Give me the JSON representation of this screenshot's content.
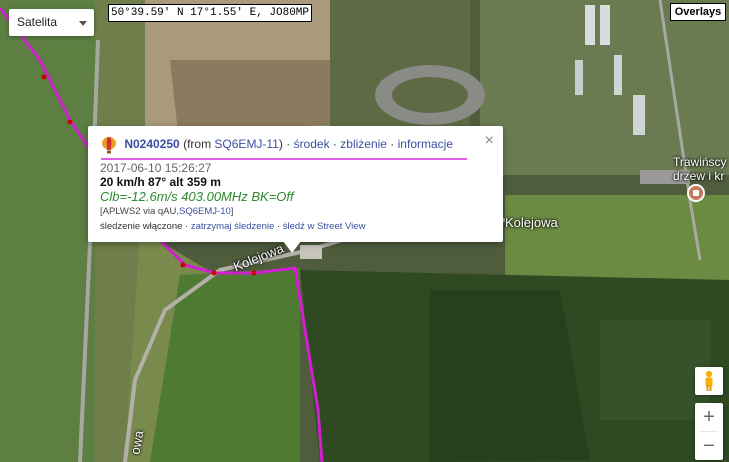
{
  "map": {
    "map_type": "Satelita",
    "coordinates": "50°39.59' N 17°1.55' E, JO80MP",
    "overlays_label": "Overlays",
    "zoom_in": "+",
    "zoom_out": "−",
    "road_label_1": "Kolejowa",
    "road_label_2": "Kolejowa",
    "road_label_3": "owa",
    "poi_label": "Trawińscy\ndrzew i kr",
    "track_color": "#d020d0",
    "marker_color": "#cc0000"
  },
  "popup": {
    "callsign": "N0240250",
    "from_prefix": "(from",
    "from_call": "SQ6EMJ-11",
    "from_suffix": ")",
    "sep": " · ",
    "link_center": "środek",
    "link_zoom": "zbliżenie",
    "link_info": "informacje",
    "timestamp": "2017-06-10 15:26:27",
    "speed_line": "20 km/h 87° alt 359 m",
    "comment": "Clb=-12.6m/s 403.00MHz BK=Off",
    "path_prefix": "[APLWS2 via qAU,",
    "path_call": "SQ6EMJ-10",
    "path_suffix": "]",
    "tracking_text": "śledzenie włączone",
    "link_stop": "zatrzymaj śledzenie",
    "link_streetview": "śledź w Street View",
    "close": "×"
  }
}
